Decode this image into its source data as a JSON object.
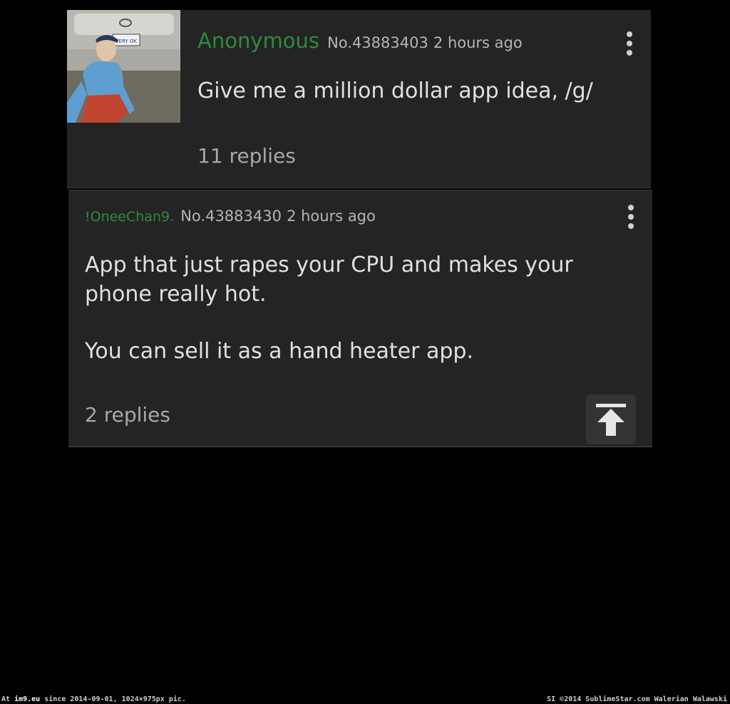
{
  "op": {
    "name": "Anonymous",
    "post_number": "No.43883403",
    "time": "2 hours ago",
    "comment": "Give me a million dollar app idea, /g/",
    "replies": "11 replies",
    "thumbnail_plate_text": "VERY OK"
  },
  "reply": {
    "name": "!OneeChan9.",
    "post_number": "No.43883430",
    "time": "2 hours ago",
    "comment_line_1": "App that just rapes your CPU and makes your phone really hot.",
    "comment_line_2": "You can sell it as a hand heater app.",
    "replies": "2 replies"
  },
  "icons": {
    "overflow": "overflow-menu-icon",
    "scroll_top": "arrow-up-to-top-icon"
  },
  "colors": {
    "name_green": "#2e8b3e",
    "post_bg": "#242424",
    "background": "#000000"
  },
  "footer": {
    "left_prefix": "At",
    "left_site": "im9.eu",
    "left_rest": "since 2014-09-01, 1024×975px pic.",
    "right": "SI ©2014 SublimeStar.com Walerian Walawski"
  }
}
